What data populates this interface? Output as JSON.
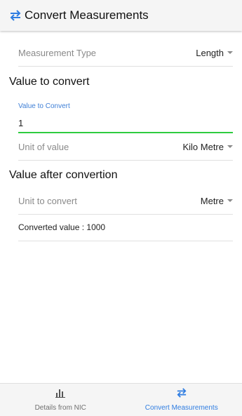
{
  "appbar": {
    "title": "Convert Measurements",
    "icon": "swap-arrows-icon"
  },
  "measurement_type": {
    "label": "Measurement Type",
    "value": "Length"
  },
  "value_section": {
    "title": "Value to convert"
  },
  "input": {
    "label": "Value to Convert",
    "value": "1"
  },
  "unit_of_value": {
    "label": "Unit of value",
    "value": "Kilo Metre"
  },
  "after_section": {
    "title": "Value after convertion"
  },
  "unit_to_convert": {
    "label": "Unit to convert",
    "value": "Metre"
  },
  "result": {
    "text": "Converted value : 1000"
  },
  "bottom_nav": {
    "items": [
      {
        "label": "Details from NIC",
        "icon": "bar-chart-icon",
        "active": false
      },
      {
        "label": "Convert Measurements",
        "icon": "swap-arrows-icon",
        "active": true
      }
    ]
  },
  "colors": {
    "accent": "#2f7de1",
    "focus_underline": "#2ecc40"
  }
}
